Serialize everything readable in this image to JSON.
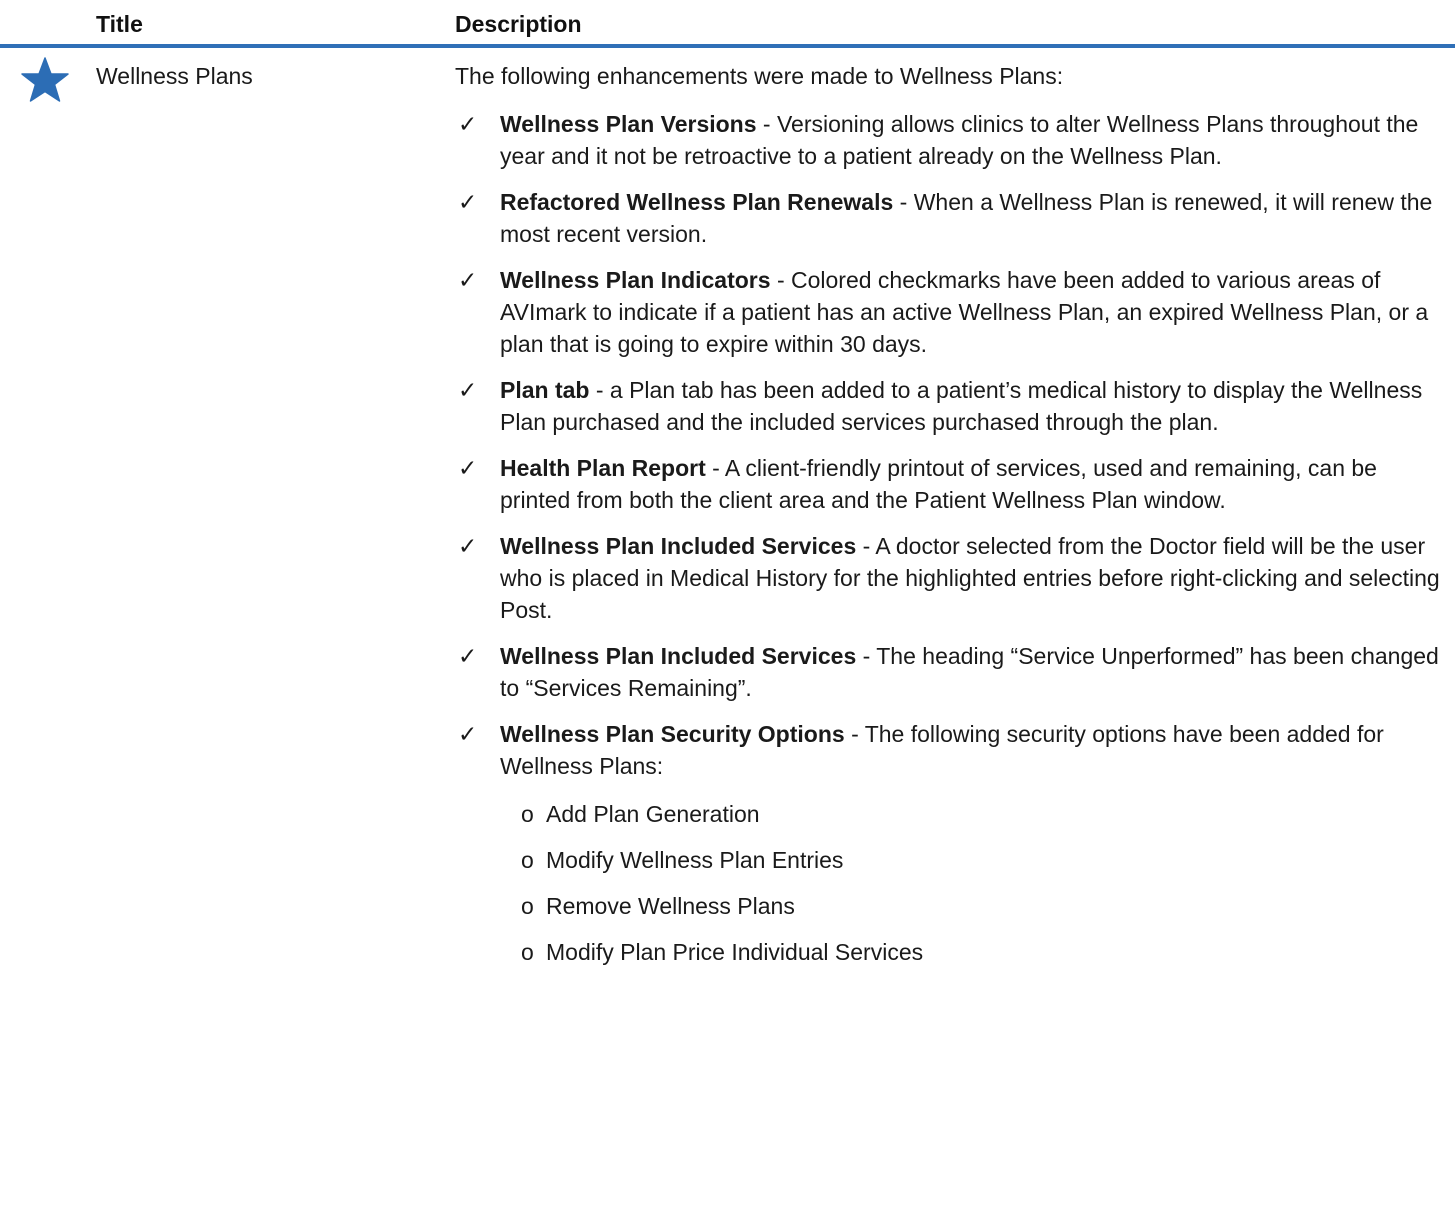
{
  "table": {
    "headers": {
      "title": "Title",
      "description": "Description"
    },
    "row": {
      "star_icon": "star-icon",
      "title": "Wellness Plans",
      "intro": "The following enhancements were made to Wellness Plans:",
      "items": [
        {
          "check": "✓",
          "title": "Wellness Plan Versions",
          "text": " - Versioning allows clinics to alter Wellness Plans throughout the year and it not be retroactive to a patient already on the Wellness Plan."
        },
        {
          "check": "✓",
          "title": "Refactored Wellness Plan Renewals",
          "text": " - When a Wellness Plan is renewed, it will renew the most recent version."
        },
        {
          "check": "✓",
          "title": "Wellness Plan Indicators",
          "text": " - Colored checkmarks have been added to various areas of AVImark to indicate if a patient has an active Wellness Plan, an expired Wellness Plan, or a plan that is going to expire within 30 days."
        },
        {
          "check": "✓",
          "title": "Plan tab",
          "text": " - a Plan tab has been added to a patient’s medical history to display the Wellness Plan purchased and the included services purchased through the plan."
        },
        {
          "check": "✓",
          "title": "Health Plan Report",
          "text": " - A client-friendly printout of services, used and remaining, can be printed from both the client area and the Patient Wellness Plan window."
        },
        {
          "check": "✓",
          "title": "Wellness Plan Included Services",
          "text": " - A doctor selected from the Doctor field will be the user who is placed in Medical History for the highlighted entries before right-clicking and selecting Post."
        },
        {
          "check": "✓",
          "title": "Wellness Plan Included Services",
          "text": " - The heading “Service Unperformed” has been changed to “Services Remaining”."
        },
        {
          "check": "✓",
          "title": "Wellness Plan Security Options",
          "text": " - The following security options have been added for Wellness Plans:"
        }
      ],
      "security_options": [
        {
          "bullet": "o",
          "label": "Add Plan Generation"
        },
        {
          "bullet": "o",
          "label": "Modify Wellness Plan Entries"
        },
        {
          "bullet": "o",
          "label": "Remove Wellness Plans"
        },
        {
          "bullet": "o",
          "label": "Modify Plan Price Individual Services"
        }
      ]
    }
  },
  "colors": {
    "header_rule": "#2f6fb7",
    "star": "#2c6db5",
    "text": "#1a1a1a"
  }
}
